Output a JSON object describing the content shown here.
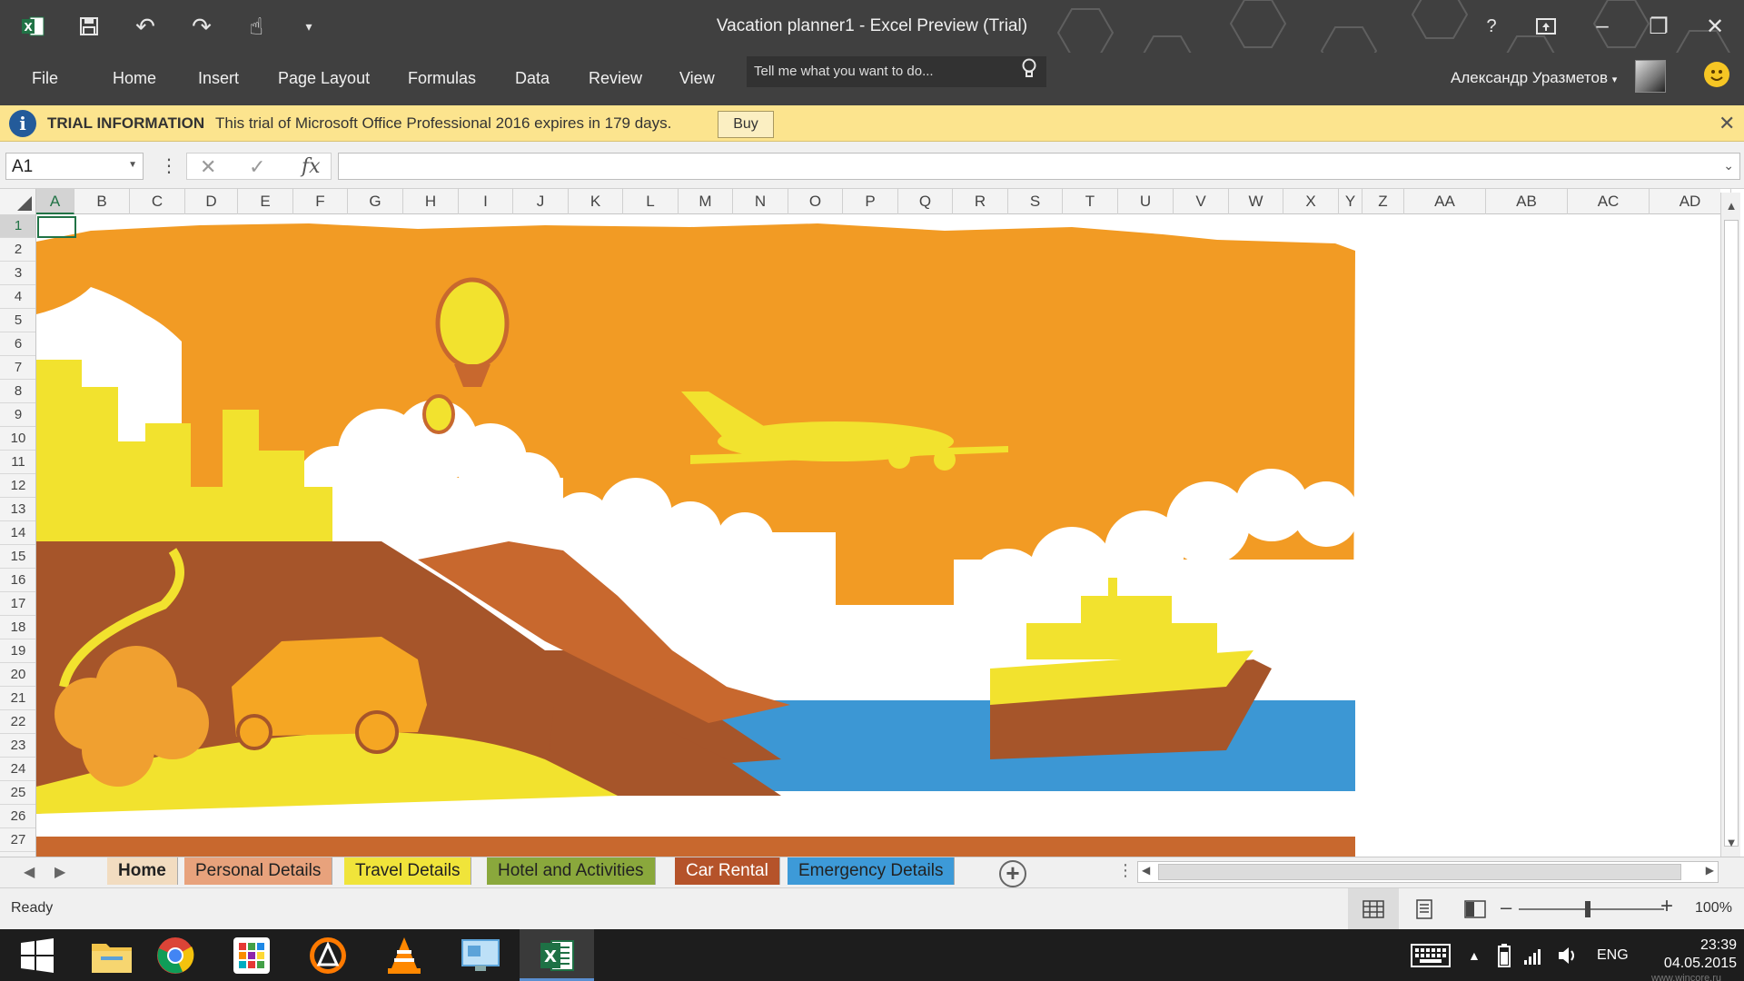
{
  "window": {
    "title": "Vacation planner1 - Excel Preview (Trial)"
  },
  "ribbon": {
    "tabs": [
      "File",
      "Home",
      "Insert",
      "Page Layout",
      "Formulas",
      "Data",
      "Review",
      "View"
    ],
    "tell_me": "Tell me what you want to do...",
    "user": "Александр Уразметов"
  },
  "trial": {
    "heading": "TRIAL INFORMATION",
    "text": "This trial of Microsoft Office Professional 2016 expires in 179 days.",
    "buy": "Buy"
  },
  "formula_bar": {
    "name_box": "A1",
    "formula": ""
  },
  "grid": {
    "columns": [
      "A",
      "B",
      "C",
      "D",
      "E",
      "F",
      "G",
      "H",
      "I",
      "J",
      "K",
      "L",
      "M",
      "N",
      "O",
      "P",
      "Q",
      "R",
      "S",
      "T",
      "U",
      "V",
      "W",
      "X",
      "Y",
      "Z",
      "AA",
      "AB",
      "AC",
      "AD"
    ],
    "rows": [
      "1",
      "2",
      "3",
      "4",
      "5",
      "6",
      "7",
      "8",
      "9",
      "10",
      "11",
      "12",
      "13",
      "14",
      "15",
      "16",
      "17",
      "18",
      "19",
      "20",
      "21",
      "22",
      "23",
      "24",
      "25",
      "26",
      "27"
    ],
    "selected_cell": "A1"
  },
  "sheets": [
    {
      "name": "Home",
      "color": "#f2dcc0",
      "active": true
    },
    {
      "name": "Personal Details",
      "color": "#e8a27c"
    },
    {
      "name": "Travel Details",
      "color": "#f0e43a"
    },
    {
      "name": "Hotel and Activities",
      "color": "#8aa83c"
    },
    {
      "name": "Car Rental",
      "color": "#b5532a"
    },
    {
      "name": "Emergency Details",
      "color": "#3d9ad8"
    }
  ],
  "status": {
    "text": "Ready",
    "zoom": "100%"
  },
  "taskbar": {
    "language": "ENG",
    "time": "23:39",
    "date": "04.05.2015",
    "watermark": "www.wincore.ru"
  },
  "colors": {
    "orange": "#f29b24",
    "brown": "#a6552a",
    "rust": "#c8682e",
    "yellow": "#f2e22e",
    "sea": "#3c97d4",
    "excel_green": "#217346"
  }
}
